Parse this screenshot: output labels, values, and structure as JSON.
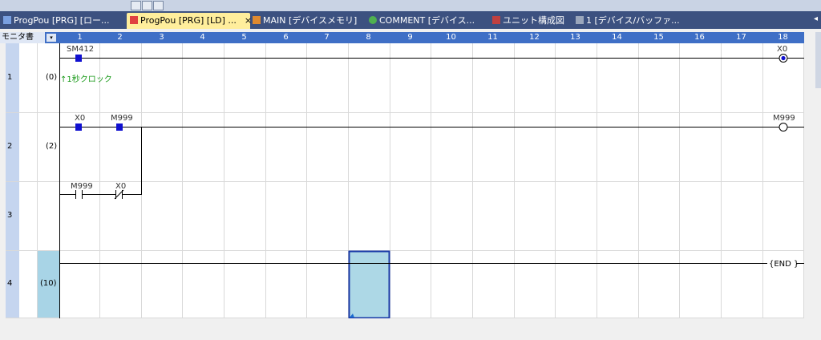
{
  "tabs": [
    {
      "label": "ProgPou [PRG] [ロー...",
      "icon": "program-icon",
      "active": false
    },
    {
      "label": "ProgPou [PRG] [LD] ...",
      "icon": "ladder-program-icon",
      "active": true
    },
    {
      "label": "MAIN [デバイスメモリ]",
      "icon": "device-memory-icon",
      "active": false
    },
    {
      "label": "COMMENT [デバイス...",
      "icon": "comment-icon",
      "active": false
    },
    {
      "label": "ユニット構成図",
      "icon": "unit-config-icon",
      "active": false
    },
    {
      "label": "1 [デバイス/バッファ...",
      "icon": "device-buffer-icon",
      "active": false
    }
  ],
  "tab_close": "×",
  "tab_more": "◂",
  "header": {
    "monitor_label": "モニタ書",
    "dropdown": "▾",
    "columns": [
      "1",
      "2",
      "3",
      "4",
      "5",
      "6",
      "7",
      "8",
      "9",
      "10",
      "11",
      "12",
      "13",
      "14",
      "15",
      "16",
      "17",
      "18"
    ]
  },
  "rows": [
    {
      "row": "1",
      "step": "(0)"
    },
    {
      "row": "2",
      "step": "(2)"
    },
    {
      "row": "3",
      "step": ""
    },
    {
      "row": "4",
      "step": "(10)"
    }
  ],
  "devices": {
    "sm412": "SM412",
    "x0_coil": "X0",
    "comment": "↑1秒クロック",
    "x0_contact": "X0",
    "m999_contact": "M999",
    "m999_coil": "M999",
    "m999_branch": "M999",
    "x0_branch": "X0",
    "end": "{END }"
  },
  "colors": {
    "tabbar": "#3c5180",
    "active_tab": "#ffee9c",
    "column_header": "#3f6fc6",
    "row_header_active": "#a8d4e6",
    "selection": "#add8e6",
    "selection_border": "#1a3aa8",
    "contact_on": "#1010d0",
    "comment_text": "#1a9a1a"
  }
}
